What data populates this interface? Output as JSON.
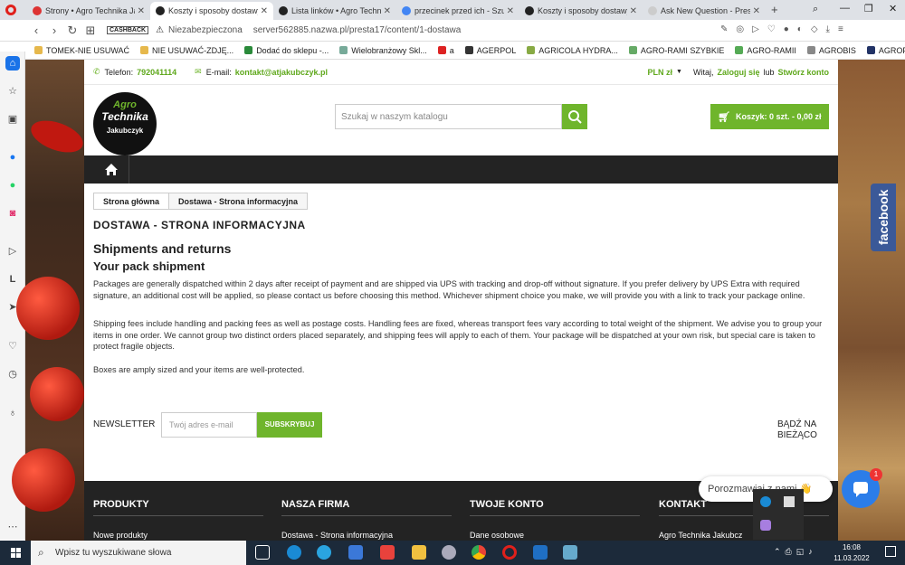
{
  "tabs": [
    {
      "label": "Strony • Agro Technika Jak",
      "color": "#d33"
    },
    {
      "label": "Koszty i sposoby dostawy",
      "color": "#222",
      "active": true
    },
    {
      "label": "Lista linków • Agro Technik",
      "color": "#222"
    },
    {
      "label": "przecinek przed ich - Szuk",
      "color": "#4285f4"
    },
    {
      "label": "Koszty i sposoby dostawy",
      "color": "#222"
    },
    {
      "label": "Ask New Question - Presta",
      "color": "#ccc"
    }
  ],
  "address": {
    "cashback": "CASHBACK",
    "security": "Niezabezpieczona",
    "url": "server562885.nazwa.pl/presta17/content/1-dostawa"
  },
  "bookmarks": [
    "TOMEK-NIE USUWAĆ",
    "NIE USUWAĆ-ZDJĘ...",
    "Dodać do sklepu -...",
    "Wielobranżowy Skl...",
    "a",
    "AGERPOL",
    "AGRICOLA HYDRA...",
    "AGRO-RAMI SZYBKIE",
    "AGRO-RAMII",
    "AGROBIS",
    "AGROPLUS"
  ],
  "header": {
    "phone_label": "Telefon:",
    "phone": "792041114",
    "email_label": "E-mail:",
    "email": "kontakt@atjakubczyk.pl",
    "currency": "PLN zł",
    "welcome": "Witaj,",
    "login": "Zaloguj się",
    "or": "lub",
    "register": "Stwórz konto"
  },
  "logo": {
    "line1": "Agro",
    "line2": "Technika",
    "line3": "Jakubczyk"
  },
  "search": {
    "placeholder": "Szukaj w naszym katalogu"
  },
  "cart": {
    "label": "Koszyk: 0 szt. - 0,00 zł"
  },
  "breadcrumb": [
    "Strona główna",
    "Dostawa - Strona informacyjna"
  ],
  "content": {
    "page_title": "DOSTAWA - STRONA INFORMACYJNA",
    "h1": "Shipments and returns",
    "h2": "Your pack shipment",
    "p1": "Packages are generally dispatched within 2 days after receipt of payment and are shipped via UPS with tracking and drop-off without signature. If you prefer delivery by UPS Extra with required signature, an additional cost will be applied, so please contact us before choosing this method. Whichever shipment choice you make, we will provide you with a link to track your package online.",
    "p2": "Shipping fees include handling and packing fees as well as postage costs. Handling fees are fixed, whereas transport fees vary according to total weight of the shipment. We advise you to group your items in one order. We cannot group two distinct orders placed separately, and shipping fees will apply to each of them. Your package will be dispatched at your own risk, but special care is taken to protect fragile objects.",
    "p3": "Boxes are amply sized and your items are well-protected."
  },
  "newsletter": {
    "label": "NEWSLETTER",
    "placeholder": "Twój adres e-mail",
    "button": "SUBSKRYBUJ",
    "side": "BĄDŹ NA BIEŻĄCO"
  },
  "footer": [
    {
      "heading": "PRODUKTY",
      "item": "Nowe produkty"
    },
    {
      "heading": "NASZA FIRMA",
      "item": "Dostawa - Strona informacyjna"
    },
    {
      "heading": "TWOJE KONTO",
      "item": "Dane osobowe"
    },
    {
      "heading": "KONTAKT",
      "item": "Agro Technika Jakubcz"
    }
  ],
  "facebook": "facebook",
  "chat": {
    "text": "Porozmawiaj z nami 👋",
    "badge": "1"
  },
  "taskbar": {
    "search": "Wpisz tu wyszukiwane słowa",
    "time": "16:08",
    "date": "11.03.2022"
  }
}
